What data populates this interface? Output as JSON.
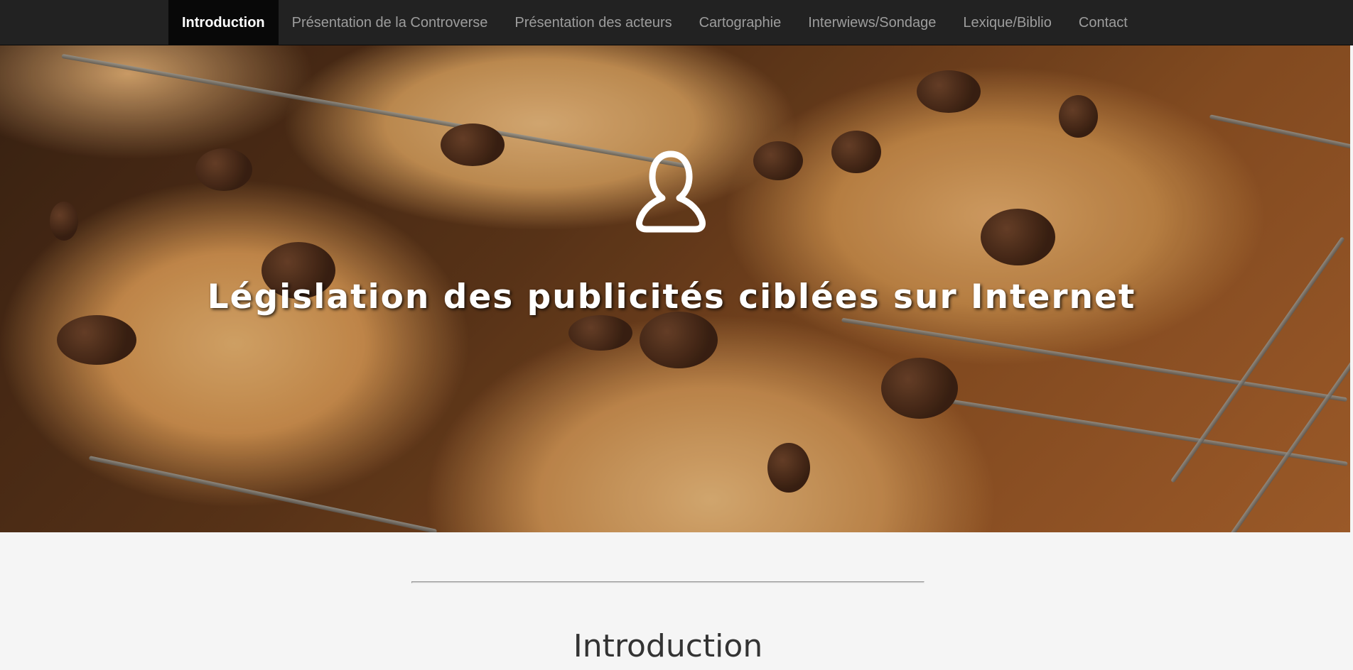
{
  "nav": {
    "items": [
      {
        "label": "Introduction",
        "active": true
      },
      {
        "label": "Présentation de la Controverse",
        "active": false
      },
      {
        "label": "Présentation des acteurs",
        "active": false
      },
      {
        "label": "Cartographie",
        "active": false
      },
      {
        "label": "Interwiews/Sondage",
        "active": false
      },
      {
        "label": "Lexique/Biblio",
        "active": false
      },
      {
        "label": "Contact",
        "active": false
      }
    ]
  },
  "hero": {
    "icon": "user-profile-icon",
    "title": "Législation des publicités ciblées sur Internet",
    "background": "cookies-on-cooling-rack-photo"
  },
  "intro": {
    "title": "Introduction"
  },
  "colors": {
    "navbar_bg": "#222222",
    "nav_active_bg": "#080808",
    "nav_text": "#9d9d9d",
    "page_bg": "#f5f5f5"
  }
}
